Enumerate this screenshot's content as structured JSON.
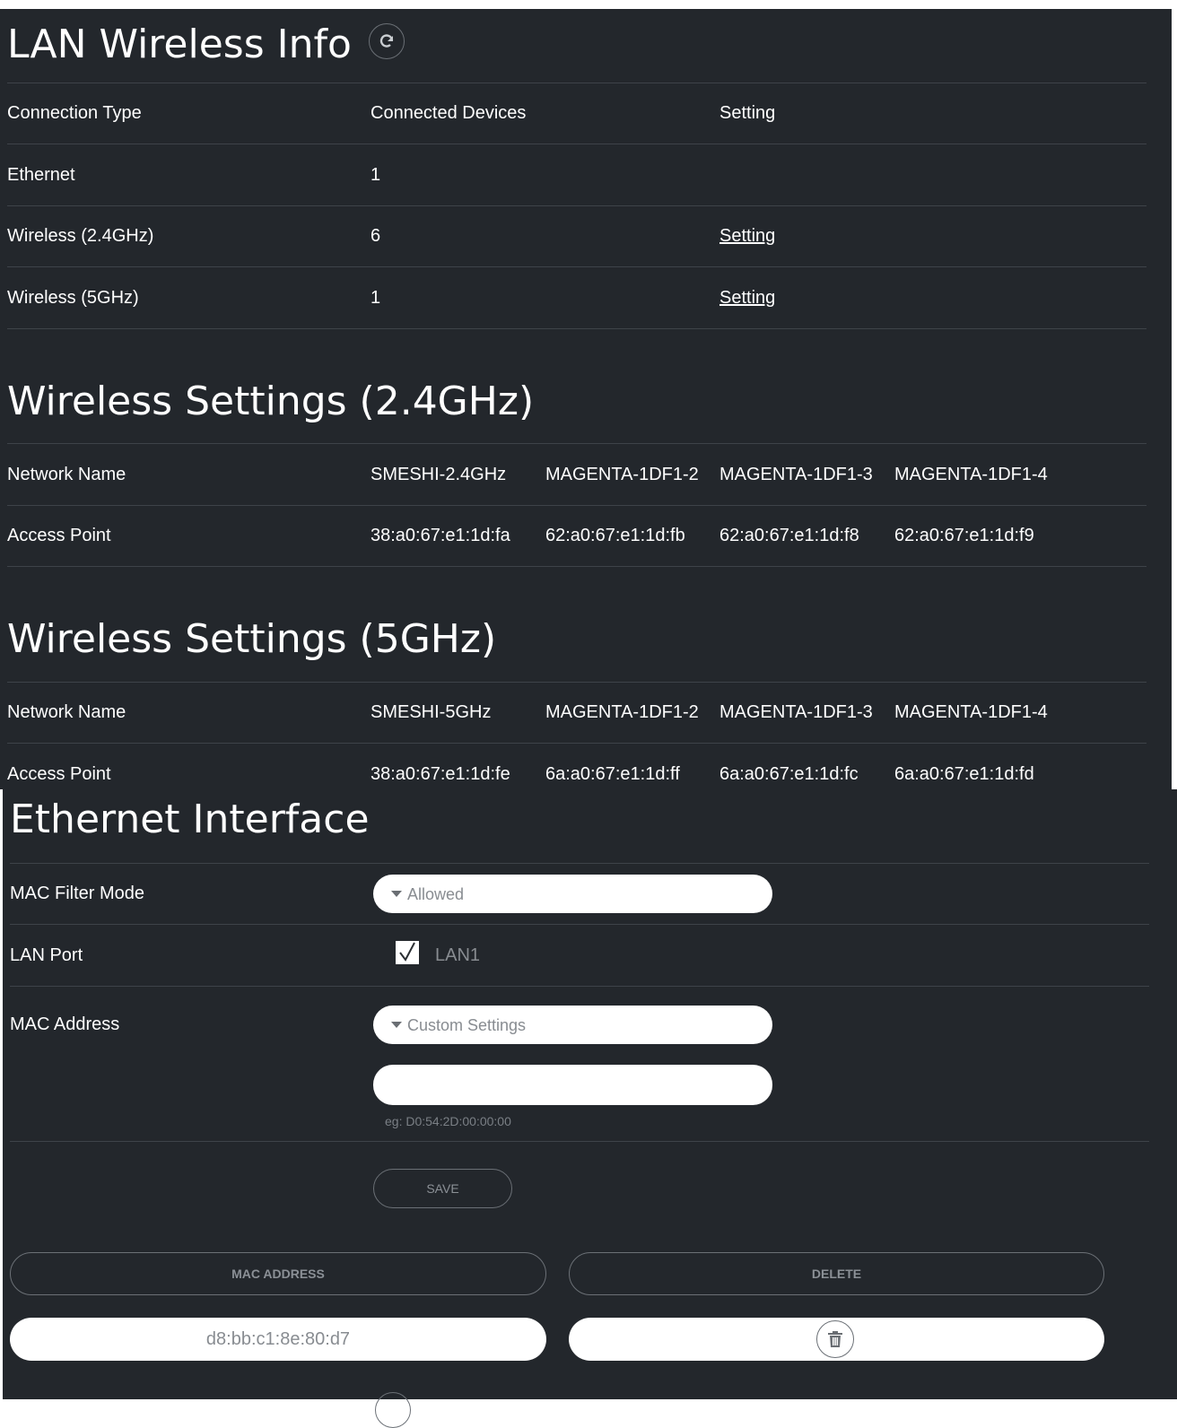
{
  "lan_wireless_info": {
    "title": "LAN Wireless Info",
    "refresh_icon": "refresh-icon",
    "headers": [
      "Connection Type",
      "Connected Devices",
      "Setting"
    ],
    "rows": [
      {
        "type": "Ethernet",
        "devices": "1",
        "setting": ""
      },
      {
        "type": "Wireless (2.4GHz)",
        "devices": "6",
        "setting": "Setting"
      },
      {
        "type": "Wireless (5GHz)",
        "devices": "1",
        "setting": "Setting"
      }
    ]
  },
  "wireless_24": {
    "title": "Wireless Settings (2.4GHz)",
    "network_name_label": "Network Name",
    "access_point_label": "Access Point",
    "network_names": [
      "SMESHI-2.4GHz",
      "MAGENTA-1DF1-2",
      "MAGENTA-1DF1-3",
      "MAGENTA-1DF1-4"
    ],
    "access_points": [
      "38:a0:67:e1:1d:fa",
      "62:a0:67:e1:1d:fb",
      "62:a0:67:e1:1d:f8",
      "62:a0:67:e1:1d:f9"
    ]
  },
  "wireless_5": {
    "title": "Wireless Settings (5GHz)",
    "network_name_label": "Network Name",
    "access_point_label": "Access Point",
    "network_names": [
      "SMESHI-5GHz",
      "MAGENTA-1DF1-2",
      "MAGENTA-1DF1-3",
      "MAGENTA-1DF1-4"
    ],
    "access_points": [
      "38:a0:67:e1:1d:fe",
      "6a:a0:67:e1:1d:ff",
      "6a:a0:67:e1:1d:fc",
      "6a:a0:67:e1:1d:fd"
    ]
  },
  "ethernet_interface": {
    "title": "Ethernet Interface",
    "mac_filter_mode_label": "MAC Filter Mode",
    "mac_filter_mode_value": "Allowed",
    "lan_port_label": "LAN Port",
    "lan_port_option": "LAN1",
    "lan_port_checked": true,
    "mac_address_label": "MAC Address",
    "mac_address_mode": "Custom Settings",
    "mac_address_input_value": "",
    "mac_address_hint": "eg: D0:54:2D:00:00:00",
    "save_label": "SAVE",
    "table_headers": [
      "MAC ADDRESS",
      "DELETE"
    ],
    "entries": [
      {
        "mac": "d8:bb:c1:8e:80:d7",
        "delete_icon": "trash-icon"
      }
    ]
  },
  "colors": {
    "background": "#23272c",
    "text": "#ffffff",
    "divider": "#3e4349",
    "muted": "#888c91"
  }
}
